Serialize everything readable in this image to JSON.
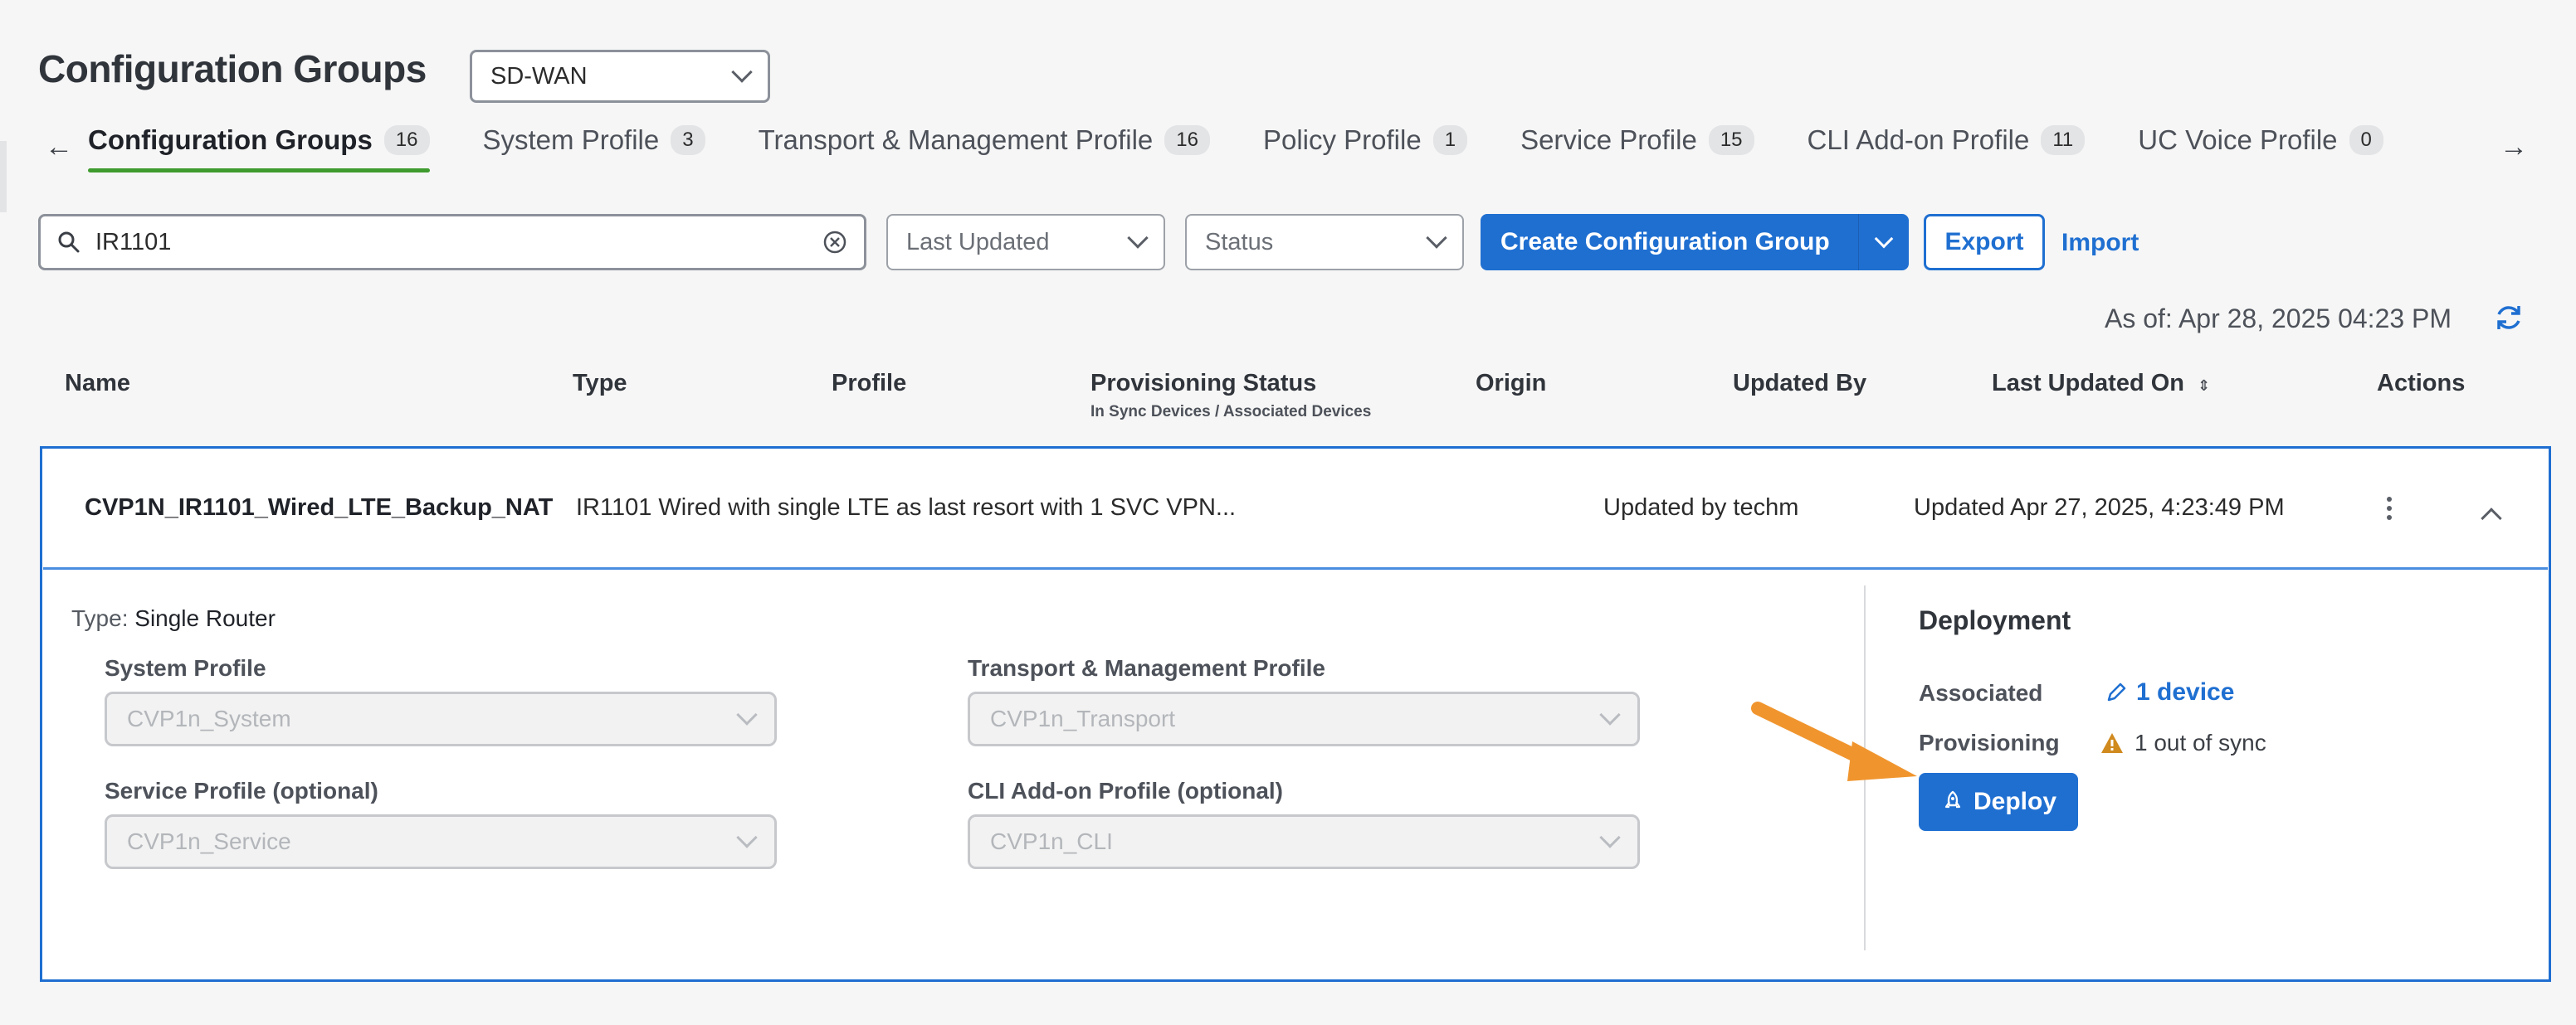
{
  "header": {
    "title": "Configuration Groups",
    "solution_select": "SD-WAN"
  },
  "tabs": [
    {
      "label": "Configuration Groups",
      "count": "16",
      "active": true
    },
    {
      "label": "System Profile",
      "count": "3"
    },
    {
      "label": "Transport & Management Profile",
      "count": "16"
    },
    {
      "label": "Policy Profile",
      "count": "1"
    },
    {
      "label": "Service Profile",
      "count": "15"
    },
    {
      "label": "CLI Add-on Profile",
      "count": "11"
    },
    {
      "label": "UC Voice Profile",
      "count": "0"
    }
  ],
  "toolbar": {
    "search_value": "IR1101",
    "sort_select": "Last Updated",
    "status_select": "Status",
    "create_label": "Create Configuration Group",
    "export_label": "Export",
    "import_label": "Import",
    "as_of": "As of: Apr 28, 2025 04:23 PM"
  },
  "table": {
    "columns": {
      "name": "Name",
      "type": "Type",
      "profile": "Profile",
      "provisioning": "Provisioning Status",
      "provisioning_sub": "In Sync Devices / Associated Devices",
      "origin": "Origin",
      "updated_by": "Updated By",
      "last_updated": "Last Updated On",
      "actions": "Actions"
    },
    "row": {
      "name": "CVP1N_IR1101_Wired_LTE_Backup_NAT",
      "description": "IR1101 Wired with single LTE as last resort with 1 SVC VPN...",
      "updated_by": "Updated by techm",
      "updated_on": "Updated Apr 27, 2025, 4:23:49 PM"
    }
  },
  "details": {
    "type_label": "Type:",
    "type_value": "Single Router",
    "system_label": "System Profile",
    "system_value": "CVP1n_System",
    "transport_label": "Transport & Management Profile",
    "transport_value": "CVP1n_Transport",
    "service_label": "Service Profile (optional)",
    "service_value": "CVP1n_Service",
    "cli_label": "CLI Add-on Profile (optional)",
    "cli_value": "CVP1n_CLI"
  },
  "deployment": {
    "title": "Deployment",
    "associated_label": "Associated",
    "associated_value": "1 device",
    "provisioning_label": "Provisioning",
    "provisioning_value": "1 out of sync",
    "deploy_label": "Deploy"
  },
  "colors": {
    "primary": "#1f6fd1",
    "active_tab": "#3f9b2e",
    "warning": "#d08a1e",
    "annotation_arrow": "#f0952e"
  }
}
